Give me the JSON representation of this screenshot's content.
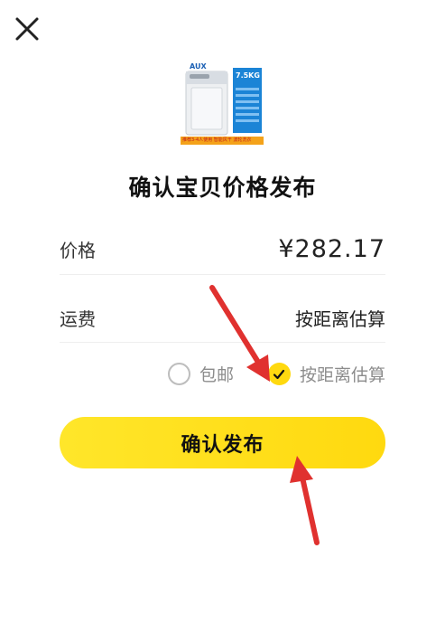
{
  "header": {
    "close_icon": "close-icon"
  },
  "product": {
    "brand": "AUX",
    "capacity": "7.5KG",
    "banner": "推荐3-4人使用 智能风干 波轮洗衣"
  },
  "dialog": {
    "title": "确认宝贝价格发布",
    "price_label": "价格",
    "price_value": "¥282.17",
    "shipping_label": "运费",
    "shipping_value": "按距离估算",
    "options": [
      {
        "label": "包邮",
        "selected": false
      },
      {
        "label": "按距离估算",
        "selected": true
      }
    ],
    "confirm_label": "确认发布"
  },
  "colors": {
    "accent": "#ffd90f",
    "arrow": "#e0312f"
  }
}
